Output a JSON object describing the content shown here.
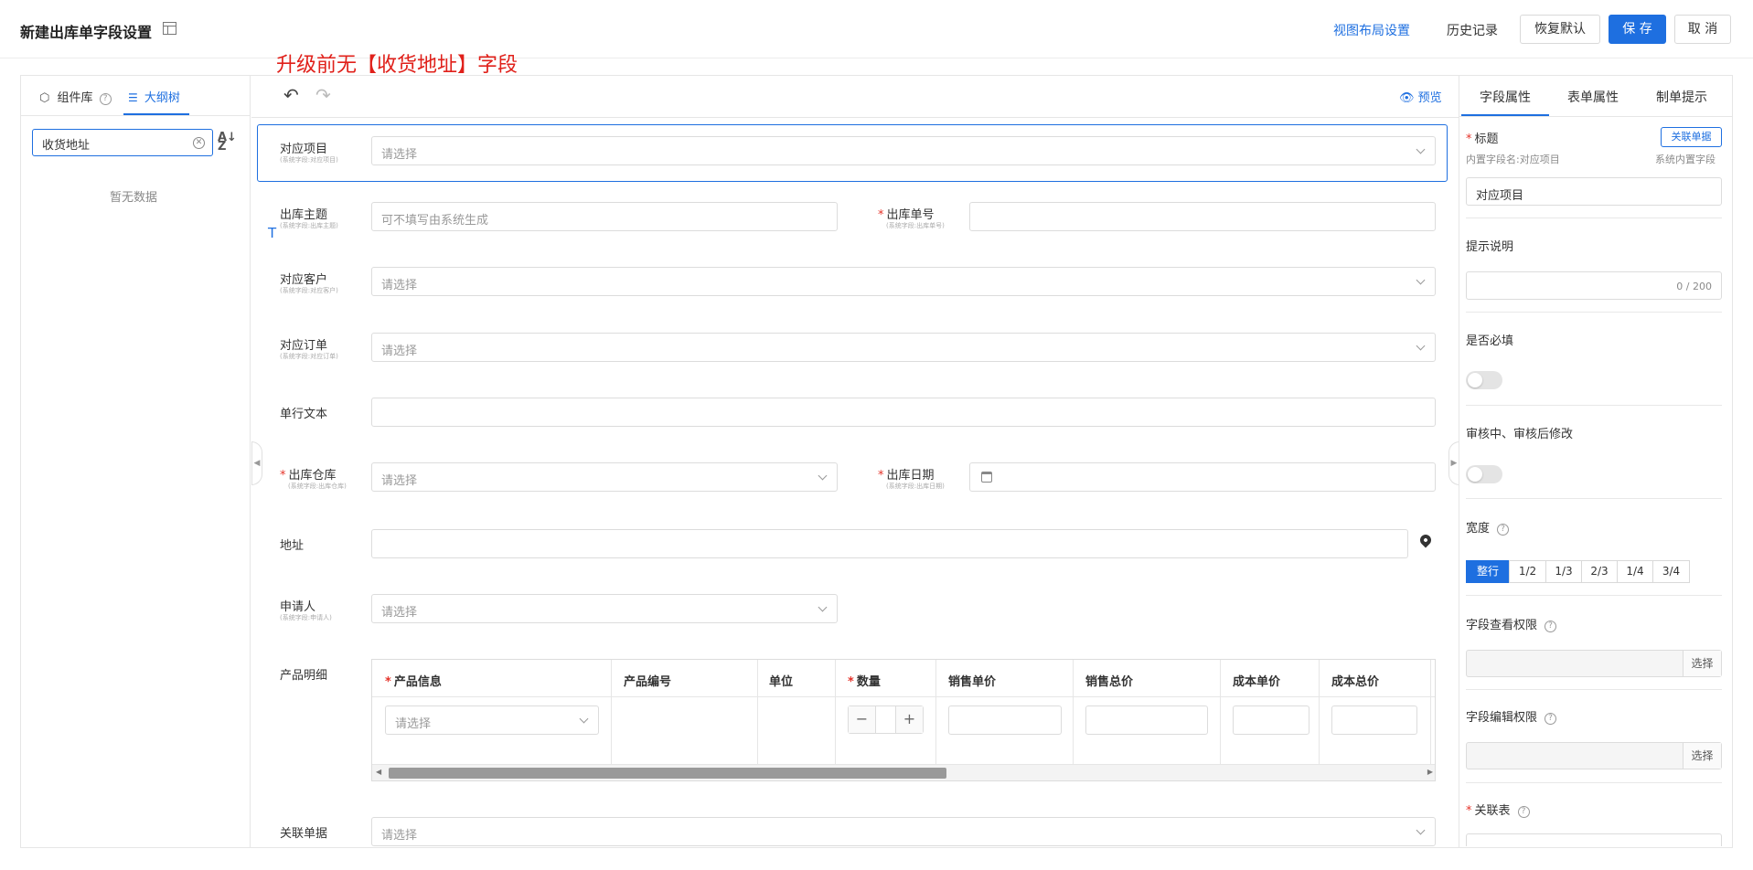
{
  "header": {
    "title": "新建出库单字段设置",
    "view_layout": "视图布局设置",
    "history": "历史记录",
    "restore_default": "恢复默认",
    "save": "保 存",
    "cancel": "取 消"
  },
  "annotation": "升级前无【收货地址】字段",
  "left_panel": {
    "tabs": [
      "组件库",
      "大纲树"
    ],
    "search_value": "收货地址",
    "empty": "暂无数据"
  },
  "toolbar": {
    "preview": "预览"
  },
  "form": {
    "fields": [
      {
        "label": "对应项目",
        "sub": "(系统字段:对应项目)",
        "placeholder": "请选择",
        "required": false
      },
      {
        "label": "出库主题",
        "sub": "(系统字段:出库主题)",
        "placeholder": "可不填写由系统生成",
        "required": false
      },
      {
        "label": "出库单号",
        "sub": "(系统字段:出库单号)",
        "placeholder": "",
        "required": true
      },
      {
        "label": "对应客户",
        "sub": "(系统字段:对应客户)",
        "placeholder": "请选择",
        "required": false
      },
      {
        "label": "对应订单",
        "sub": "(系统字段:对应订单)",
        "placeholder": "请选择",
        "required": false
      },
      {
        "label": "单行文本",
        "sub": "",
        "placeholder": "",
        "required": false
      },
      {
        "label": "出库仓库",
        "sub": "(系统字段:出库仓库)",
        "placeholder": "请选择",
        "required": true
      },
      {
        "label": "出库日期",
        "sub": "(系统字段:出库日期)",
        "placeholder": "",
        "required": true
      },
      {
        "label": "地址",
        "sub": "",
        "placeholder": "",
        "required": false
      },
      {
        "label": "申请人",
        "sub": "(系统字段:申请人)",
        "placeholder": "请选择",
        "required": false
      },
      {
        "label": "产品明细",
        "sub": "",
        "placeholder": "",
        "required": false
      },
      {
        "label": "关联单据",
        "sub": "",
        "placeholder": "请选择",
        "required": false
      }
    ],
    "table": {
      "columns": [
        "产品信息",
        "产品编号",
        "单位",
        "数量",
        "销售单价",
        "销售总价",
        "成本单价",
        "成本总价"
      ],
      "select_placeholder": "请选择",
      "minus": "−",
      "plus": "+"
    }
  },
  "right_panel": {
    "tabs": [
      "字段属性",
      "表单属性",
      "制单提示"
    ],
    "title_label": "标题",
    "link_doc_button": "关联单据",
    "builtin_name": "内置字段名:对应项目",
    "system_builtin": "系统内置字段",
    "title_value": "对应项目",
    "hint_label": "提示说明",
    "hint_count": "0 / 200",
    "required_label": "是否必填",
    "required_on": false,
    "editable_label": "审核中、审核后修改",
    "editable_on": false,
    "width_label": "宽度",
    "width_options": [
      "整行",
      "1/2",
      "1/3",
      "2/3",
      "1/4",
      "3/4"
    ],
    "width_selected": "整行",
    "view_perm_label": "字段查看权限",
    "edit_perm_label": "字段编辑权限",
    "select_button": "选择",
    "link_table_label": "关联表"
  },
  "colors": {
    "primary": "#1e6fe0",
    "required": "#e5332a",
    "annotation": "#e0201a"
  }
}
